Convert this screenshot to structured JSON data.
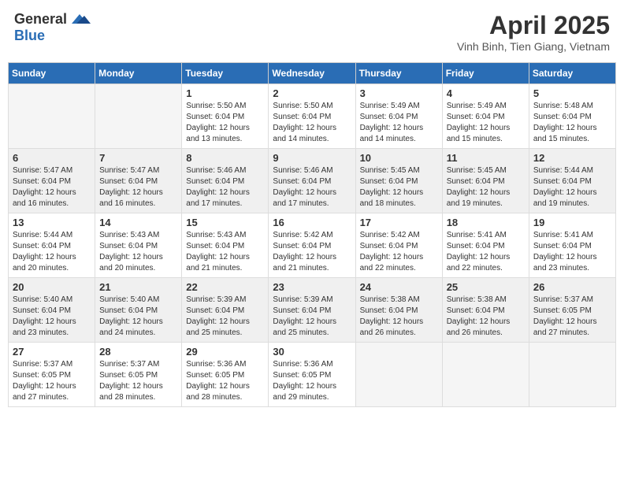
{
  "header": {
    "logo_general": "General",
    "logo_blue": "Blue",
    "month_title": "April 2025",
    "location": "Vinh Binh, Tien Giang, Vietnam"
  },
  "weekdays": [
    "Sunday",
    "Monday",
    "Tuesday",
    "Wednesday",
    "Thursday",
    "Friday",
    "Saturday"
  ],
  "weeks": [
    [
      {
        "day": "",
        "sunrise": "",
        "sunset": "",
        "daylight": ""
      },
      {
        "day": "",
        "sunrise": "",
        "sunset": "",
        "daylight": ""
      },
      {
        "day": "1",
        "sunrise": "Sunrise: 5:50 AM",
        "sunset": "Sunset: 6:04 PM",
        "daylight": "Daylight: 12 hours and 13 minutes."
      },
      {
        "day": "2",
        "sunrise": "Sunrise: 5:50 AM",
        "sunset": "Sunset: 6:04 PM",
        "daylight": "Daylight: 12 hours and 14 minutes."
      },
      {
        "day": "3",
        "sunrise": "Sunrise: 5:49 AM",
        "sunset": "Sunset: 6:04 PM",
        "daylight": "Daylight: 12 hours and 14 minutes."
      },
      {
        "day": "4",
        "sunrise": "Sunrise: 5:49 AM",
        "sunset": "Sunset: 6:04 PM",
        "daylight": "Daylight: 12 hours and 15 minutes."
      },
      {
        "day": "5",
        "sunrise": "Sunrise: 5:48 AM",
        "sunset": "Sunset: 6:04 PM",
        "daylight": "Daylight: 12 hours and 15 minutes."
      }
    ],
    [
      {
        "day": "6",
        "sunrise": "Sunrise: 5:47 AM",
        "sunset": "Sunset: 6:04 PM",
        "daylight": "Daylight: 12 hours and 16 minutes."
      },
      {
        "day": "7",
        "sunrise": "Sunrise: 5:47 AM",
        "sunset": "Sunset: 6:04 PM",
        "daylight": "Daylight: 12 hours and 16 minutes."
      },
      {
        "day": "8",
        "sunrise": "Sunrise: 5:46 AM",
        "sunset": "Sunset: 6:04 PM",
        "daylight": "Daylight: 12 hours and 17 minutes."
      },
      {
        "day": "9",
        "sunrise": "Sunrise: 5:46 AM",
        "sunset": "Sunset: 6:04 PM",
        "daylight": "Daylight: 12 hours and 17 minutes."
      },
      {
        "day": "10",
        "sunrise": "Sunrise: 5:45 AM",
        "sunset": "Sunset: 6:04 PM",
        "daylight": "Daylight: 12 hours and 18 minutes."
      },
      {
        "day": "11",
        "sunrise": "Sunrise: 5:45 AM",
        "sunset": "Sunset: 6:04 PM",
        "daylight": "Daylight: 12 hours and 19 minutes."
      },
      {
        "day": "12",
        "sunrise": "Sunrise: 5:44 AM",
        "sunset": "Sunset: 6:04 PM",
        "daylight": "Daylight: 12 hours and 19 minutes."
      }
    ],
    [
      {
        "day": "13",
        "sunrise": "Sunrise: 5:44 AM",
        "sunset": "Sunset: 6:04 PM",
        "daylight": "Daylight: 12 hours and 20 minutes."
      },
      {
        "day": "14",
        "sunrise": "Sunrise: 5:43 AM",
        "sunset": "Sunset: 6:04 PM",
        "daylight": "Daylight: 12 hours and 20 minutes."
      },
      {
        "day": "15",
        "sunrise": "Sunrise: 5:43 AM",
        "sunset": "Sunset: 6:04 PM",
        "daylight": "Daylight: 12 hours and 21 minutes."
      },
      {
        "day": "16",
        "sunrise": "Sunrise: 5:42 AM",
        "sunset": "Sunset: 6:04 PM",
        "daylight": "Daylight: 12 hours and 21 minutes."
      },
      {
        "day": "17",
        "sunrise": "Sunrise: 5:42 AM",
        "sunset": "Sunset: 6:04 PM",
        "daylight": "Daylight: 12 hours and 22 minutes."
      },
      {
        "day": "18",
        "sunrise": "Sunrise: 5:41 AM",
        "sunset": "Sunset: 6:04 PM",
        "daylight": "Daylight: 12 hours and 22 minutes."
      },
      {
        "day": "19",
        "sunrise": "Sunrise: 5:41 AM",
        "sunset": "Sunset: 6:04 PM",
        "daylight": "Daylight: 12 hours and 23 minutes."
      }
    ],
    [
      {
        "day": "20",
        "sunrise": "Sunrise: 5:40 AM",
        "sunset": "Sunset: 6:04 PM",
        "daylight": "Daylight: 12 hours and 23 minutes."
      },
      {
        "day": "21",
        "sunrise": "Sunrise: 5:40 AM",
        "sunset": "Sunset: 6:04 PM",
        "daylight": "Daylight: 12 hours and 24 minutes."
      },
      {
        "day": "22",
        "sunrise": "Sunrise: 5:39 AM",
        "sunset": "Sunset: 6:04 PM",
        "daylight": "Daylight: 12 hours and 25 minutes."
      },
      {
        "day": "23",
        "sunrise": "Sunrise: 5:39 AM",
        "sunset": "Sunset: 6:04 PM",
        "daylight": "Daylight: 12 hours and 25 minutes."
      },
      {
        "day": "24",
        "sunrise": "Sunrise: 5:38 AM",
        "sunset": "Sunset: 6:04 PM",
        "daylight": "Daylight: 12 hours and 26 minutes."
      },
      {
        "day": "25",
        "sunrise": "Sunrise: 5:38 AM",
        "sunset": "Sunset: 6:04 PM",
        "daylight": "Daylight: 12 hours and 26 minutes."
      },
      {
        "day": "26",
        "sunrise": "Sunrise: 5:37 AM",
        "sunset": "Sunset: 6:05 PM",
        "daylight": "Daylight: 12 hours and 27 minutes."
      }
    ],
    [
      {
        "day": "27",
        "sunrise": "Sunrise: 5:37 AM",
        "sunset": "Sunset: 6:05 PM",
        "daylight": "Daylight: 12 hours and 27 minutes."
      },
      {
        "day": "28",
        "sunrise": "Sunrise: 5:37 AM",
        "sunset": "Sunset: 6:05 PM",
        "daylight": "Daylight: 12 hours and 28 minutes."
      },
      {
        "day": "29",
        "sunrise": "Sunrise: 5:36 AM",
        "sunset": "Sunset: 6:05 PM",
        "daylight": "Daylight: 12 hours and 28 minutes."
      },
      {
        "day": "30",
        "sunrise": "Sunrise: 5:36 AM",
        "sunset": "Sunset: 6:05 PM",
        "daylight": "Daylight: 12 hours and 29 minutes."
      },
      {
        "day": "",
        "sunrise": "",
        "sunset": "",
        "daylight": ""
      },
      {
        "day": "",
        "sunrise": "",
        "sunset": "",
        "daylight": ""
      },
      {
        "day": "",
        "sunrise": "",
        "sunset": "",
        "daylight": ""
      }
    ]
  ]
}
